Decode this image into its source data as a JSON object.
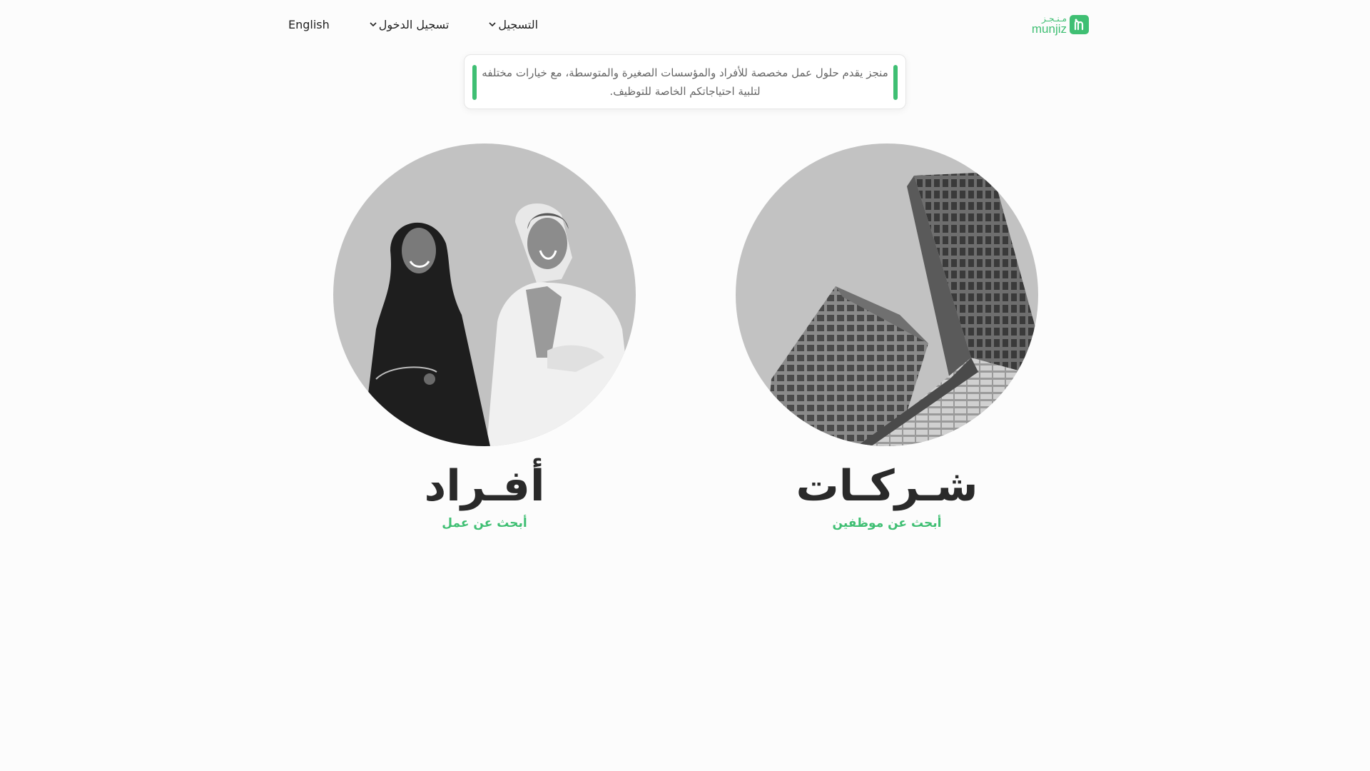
{
  "header": {
    "language_label": "English",
    "login_label": "تسجيل الدخول",
    "register_label": "التسجيل",
    "logo": {
      "arabic": "مـنـجـز",
      "latin": "munjiz",
      "mark_icon": "munjiz-m-icon"
    }
  },
  "notice": {
    "text": "منجز يقدم حلول عمل مخصصة للأفراد والمؤسسات الصغيرة والمتوسطة، مع خيارات مختلفه لتلبية احتياجاتكم الخاصة للتوظيف."
  },
  "cards": {
    "companies": {
      "title": "شـركـات",
      "subtitle": "أبحث عن موظفين"
    },
    "individuals": {
      "title": "أفـراد",
      "subtitle": "أبحث عن عمل"
    }
  },
  "colors": {
    "accent": "#3fbf73",
    "background": "#fcfcfc",
    "circle_bg": "#c2c2c2",
    "title": "#2a2a2a"
  }
}
